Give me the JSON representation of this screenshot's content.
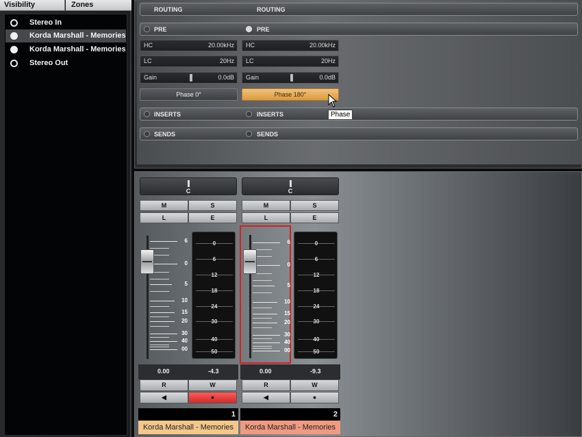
{
  "left_panel": {
    "tabs": [
      "Visibility",
      "Zones"
    ],
    "items": [
      {
        "label": "Stereo In",
        "checked": false
      },
      {
        "label": "Korda Marshall - Memories",
        "checked": true
      },
      {
        "label": "Korda Marshall - Memories",
        "checked": true
      },
      {
        "label": "Stereo Out",
        "checked": false
      }
    ]
  },
  "channels": [
    {
      "routing": "ROUTING",
      "pre": "PRE",
      "hc_label": "HC",
      "hc_value": "20.00kHz",
      "lc_label": "LC",
      "lc_value": "20Hz",
      "gain_label": "Gain",
      "gain_value": "0.0dB",
      "phase": "Phase 0°",
      "phase_active": false,
      "inserts": "INSERTS",
      "sends": "SENDS",
      "pan": "C",
      "m": "M",
      "s": "S",
      "l": "L",
      "e": "E",
      "fader_value": "0.00",
      "meter_value": "-4.3",
      "r": "R",
      "w": "W",
      "write_active": true,
      "number": "1",
      "name": "Korda Marshall - Memories",
      "name_color": "#f4c78a"
    },
    {
      "routing": "ROUTING",
      "pre": "PRE",
      "hc_label": "HC",
      "hc_value": "20.00kHz",
      "lc_label": "LC",
      "lc_value": "20Hz",
      "gain_label": "Gain",
      "gain_value": "0.0dB",
      "phase": "Phase 180°",
      "phase_active": true,
      "inserts": "INSERTS",
      "sends": "SENDS",
      "pan": "C",
      "m": "M",
      "s": "S",
      "l": "L",
      "e": "E",
      "fader_value": "0.00",
      "meter_value": "-9.3",
      "r": "R",
      "w": "W",
      "write_active": false,
      "number": "2",
      "name": "Korda Marshall - Memories",
      "name_color": "#f09a82"
    }
  ],
  "fader_scale": [
    "6",
    "0",
    "5",
    "10",
    "15",
    "20",
    "30",
    "40",
    "00"
  ],
  "meter_scale": [
    "0",
    "6",
    "12",
    "18",
    "24",
    "30",
    "40",
    "50"
  ],
  "tooltip": "Phase",
  "colors": {
    "phase_active": "#e9ad58",
    "write_active": "#e23a3a",
    "fader_highlight": "#d42020"
  }
}
